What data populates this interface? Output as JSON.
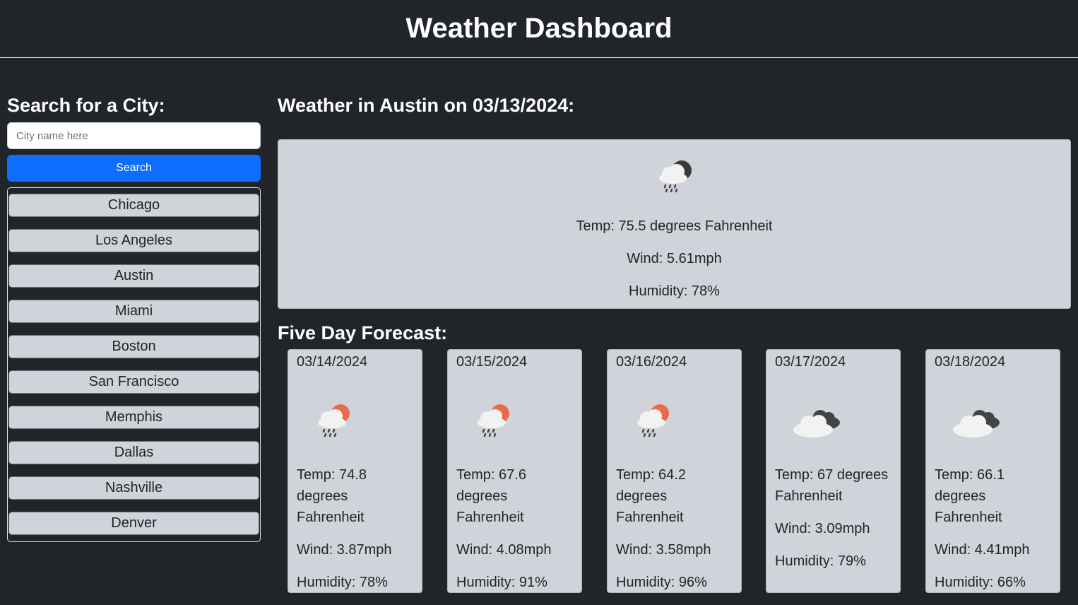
{
  "header": {
    "title": "Weather Dashboard"
  },
  "search": {
    "heading": "Search for a City:",
    "placeholder": "City name here",
    "button_label": "Search"
  },
  "history": [
    "Chicago",
    "Los Angeles",
    "Austin",
    "Miami",
    "Boston",
    "San Francisco",
    "Memphis",
    "Dallas",
    "Nashville",
    "Denver"
  ],
  "current": {
    "heading": "Weather in Austin on 03/13/2024:",
    "icon": "rain-night-icon",
    "temp": "Temp: 75.5 degrees Fahrenheit",
    "wind": "Wind: 5.61mph",
    "humidity": "Humidity: 78%"
  },
  "forecast": {
    "heading": "Five Day Forecast:",
    "days": [
      {
        "date": "03/14/2024",
        "icon": "rain-day-icon",
        "temp": "Temp: 74.8 degrees Fahrenheit",
        "wind": "Wind: 3.87mph",
        "humidity": "Humidity: 78%"
      },
      {
        "date": "03/15/2024",
        "icon": "rain-day-icon",
        "temp": "Temp: 67.6 degrees Fahrenheit",
        "wind": "Wind: 4.08mph",
        "humidity": "Humidity: 91%"
      },
      {
        "date": "03/16/2024",
        "icon": "rain-day-icon",
        "temp": "Temp: 64.2 degrees Fahrenheit",
        "wind": "Wind: 3.58mph",
        "humidity": "Humidity: 96%"
      },
      {
        "date": "03/17/2024",
        "icon": "broken-clouds-icon",
        "temp": "Temp: 67 degrees Fahrenheit",
        "wind": "Wind: 3.09mph",
        "humidity": "Humidity: 79%"
      },
      {
        "date": "03/18/2024",
        "icon": "broken-clouds-icon",
        "temp": "Temp: 66.1 degrees Fahrenheit",
        "wind": "Wind: 4.41mph",
        "humidity": "Humidity: 66%"
      }
    ]
  },
  "colors": {
    "background": "#212529",
    "card": "#d0d4da",
    "accent": "#0d6efd"
  }
}
